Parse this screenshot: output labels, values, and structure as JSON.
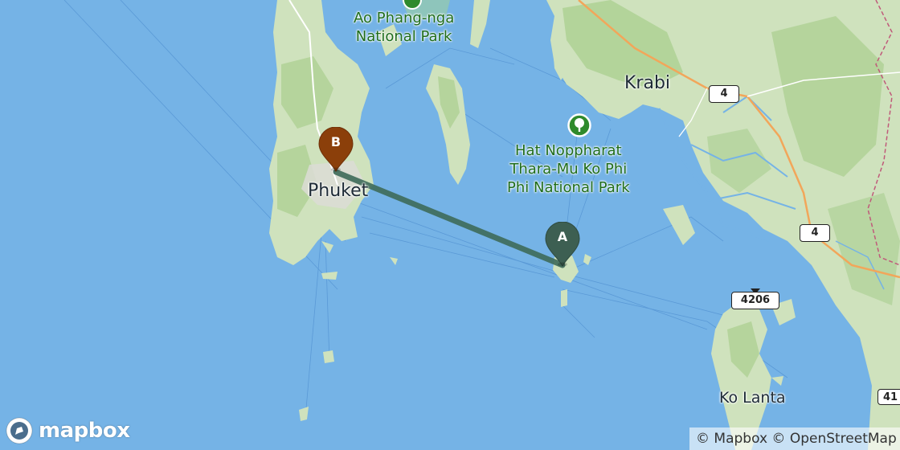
{
  "map": {
    "labels": {
      "phuket": "Phuket",
      "krabi": "Krabi",
      "ko_lanta": "Ko Lanta"
    },
    "parks": {
      "ao_phang_nga": [
        "Ao Phang-nga",
        "National Park"
      ],
      "hat_noppharat": [
        "Hat Noppharat",
        "Thara-Mu Ko Phi",
        "Phi National Park"
      ]
    },
    "highways": {
      "route_4_north": "4",
      "route_4_south": "4",
      "route_4206": "4206",
      "route_partial": "41"
    },
    "markers": {
      "origin": {
        "letter": "A",
        "color": "#3d5f52"
      },
      "destination": {
        "letter": "B",
        "color": "#8b3f0a"
      }
    },
    "route": {
      "color": "#3e6b5a"
    },
    "colors": {
      "water": "#75b3e6",
      "land": "#cfe2bd",
      "forest": "#a9cf8f",
      "park": "#a8d790"
    }
  },
  "branding": {
    "logo_text": "mapbox",
    "attribution": "© Mapbox © OpenStreetMap"
  }
}
